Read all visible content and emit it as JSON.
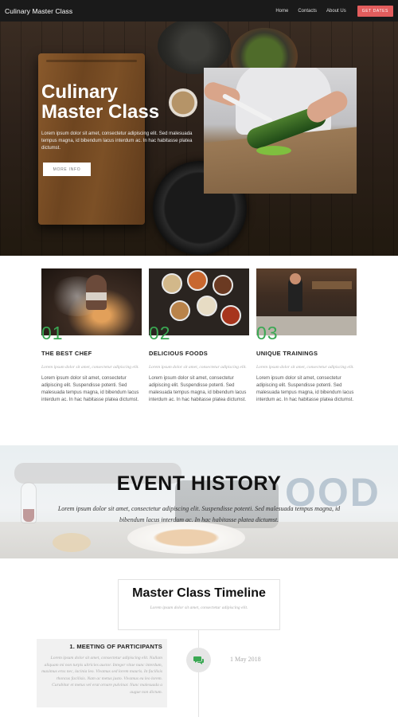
{
  "nav": {
    "brand": "Culinary Master Class",
    "links": [
      {
        "label": "Home"
      },
      {
        "label": "Contacts"
      },
      {
        "label": "About Us"
      }
    ],
    "cta": "GET DATES"
  },
  "hero": {
    "title": "Culinary Master Class",
    "text": "Lorem ipsum dolor sit amet, consectetur adipiscing elit. Sed malesuada tempus magna, id bibendum lacus interdum ac. In hac habitasse platea dictumst.",
    "button": "MORE INFO"
  },
  "features": [
    {
      "num": "01",
      "title": "THE BEST CHEF",
      "italic": "Lorem ipsum dolor sit amet, consectetur adipiscing elit.",
      "text": "Lorem ipsum dolor sit amet, consectetur adipiscing elit. Suspendisse potenti. Sed malesuada tempus magna, id bibendum lacus interdum ac. In hac habitasse platea dictumst."
    },
    {
      "num": "02",
      "title": "DELICIOUS FOODS",
      "italic": "Lorem ipsum dolor sit amet, consectetur adipiscing elit.",
      "text": "Lorem ipsum dolor sit amet, consectetur adipiscing elit. Suspendisse potenti. Sed malesuada tempus magna, id bibendum lacus interdum ac. In hac habitasse platea dictumst."
    },
    {
      "num": "03",
      "title": "UNIQUE TRAININGS",
      "italic": "Lorem ipsum dolor sit amet, consectetur adipiscing elit.",
      "text": "Lorem ipsum dolor sit amet, consectetur adipiscing elit. Suspendisse potenti. Sed malesuada tempus magna, id bibendum lacus interdum ac. In hac habitasse platea dictumst."
    }
  ],
  "event": {
    "title": "EVENT HISTORY",
    "text": "Lorem ipsum dolor sit amet, consectetur adipiscing elit. Suspendisse potenti. Sed malesuada tempus magna, id bibendum lacus interdum ac. In hac habitasse platea dictumst.",
    "bg_word": "OOD"
  },
  "timeline": {
    "title": "Master Class Timeline",
    "subtitle": "Lorem ipsum dolor sit amet, consectetur adipiscing elit.",
    "items": [
      {
        "title": "1. MEETING OF PARTICIPANTS",
        "text": "Lorem ipsum dolor sit amet, consectetur adipiscing elit. Nullam aliquam mi non turpis ultricies auctor. Integer vitae nunc interdum, maximus eros nec, lacinia leo. Vivamus sed lorem mauris. In facilisis rhoncus facilisis. Nam ac metus justo. Vivamus eu leo lorem. Curabitur et metus vel erat ornare pulvinar. Nunc malesuada a augue non dictum.",
        "date": "1 May 2018",
        "icon": "chat-bubbles-icon"
      }
    ]
  },
  "colors": {
    "accent_green": "#3aa853",
    "cta_red": "#e35d5d",
    "nav_bg": "#1a1a1a"
  }
}
